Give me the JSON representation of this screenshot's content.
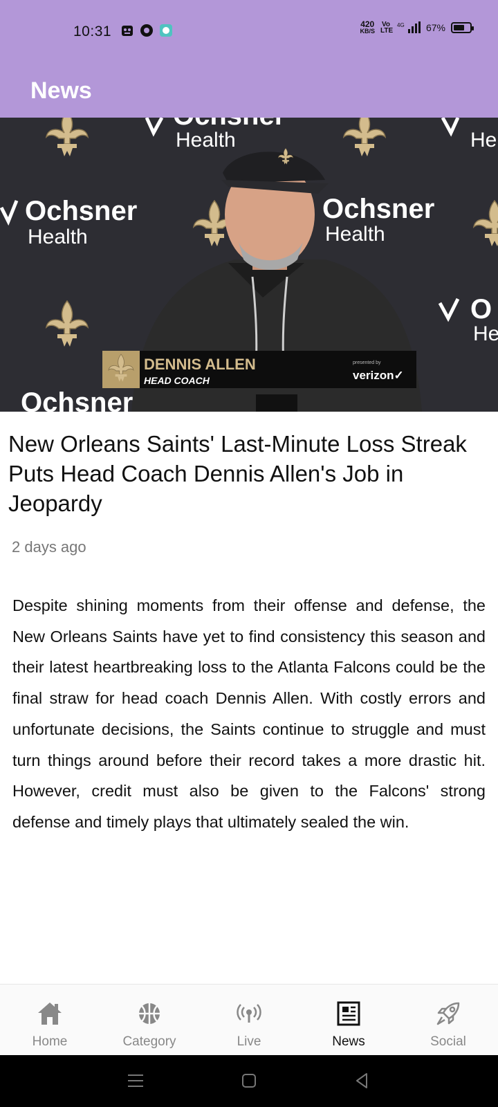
{
  "status_bar": {
    "time": "10:31",
    "net_speed_value": "420",
    "net_speed_unit": "KB/S",
    "volte": "Vo LTE",
    "network": "4G",
    "battery_percent": "67%",
    "battery_level": 0.67
  },
  "header": {
    "title": "News"
  },
  "hero": {
    "lower_third_name": "DENNIS ALLEN",
    "lower_third_role": "HEAD COACH",
    "lower_third_sponsor_prefix": "presented by",
    "lower_third_sponsor": "verizon✓",
    "backdrop_brand_1": "Ochsner",
    "backdrop_brand_2": "Health"
  },
  "article": {
    "title": "New Orleans Saints' Last-Minute Loss Streak Puts Head Coach Dennis Allen's Job in Jeopardy",
    "date": "2 days ago",
    "body": "Despite shining moments from their offense and defense, the New Orleans Saints have yet to find consistency this season and their latest heartbreaking loss to the Atlanta Falcons could be the final straw for head coach Dennis Allen. With costly errors and unfortunate decisions, the Saints continue to struggle and must turn things around before their record takes a more drastic hit. However, credit must also be given to the Falcons' strong defense and timely plays that ultimately sealed the win."
  },
  "bottom_nav": {
    "items": [
      {
        "label": "Home",
        "icon": "home-icon",
        "active": false
      },
      {
        "label": "Category",
        "icon": "basketball-icon",
        "active": false
      },
      {
        "label": "Live",
        "icon": "broadcast-icon",
        "active": false
      },
      {
        "label": "News",
        "icon": "newspaper-icon",
        "active": true
      },
      {
        "label": "Social",
        "icon": "rocket-icon",
        "active": false
      }
    ]
  },
  "colors": {
    "header_bg": "#b397d8",
    "saints_gold": "#d3bc8d",
    "active_nav": "#111111",
    "inactive_nav": "#888888"
  }
}
